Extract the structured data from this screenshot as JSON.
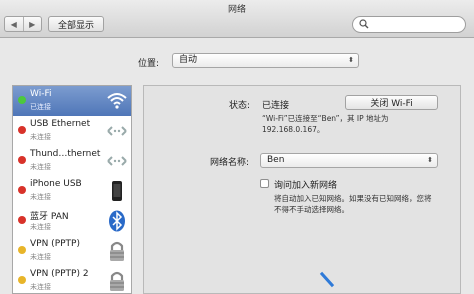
{
  "window": {
    "title": "网络"
  },
  "toolbar": {
    "back_glyph": "◀",
    "forward_glyph": "▶",
    "show_all_label": "全部显示",
    "search_placeholder": ""
  },
  "location": {
    "label": "位置:",
    "value": "自动"
  },
  "services": [
    {
      "name": "Wi-Fi",
      "status": "已连接",
      "dot_color": "#4cc93c",
      "icon": "wifi-icon",
      "selected": true
    },
    {
      "name": "USB Ethernet",
      "status": "未连接",
      "dot_color": "#d8322a",
      "icon": "ethernet-icon",
      "selected": false
    },
    {
      "name": "Thund…thernet",
      "status": "未连接",
      "dot_color": "#d8322a",
      "icon": "ethernet-icon",
      "selected": false
    },
    {
      "name": "iPhone USB",
      "status": "未连接",
      "dot_color": "#d8322a",
      "icon": "iphone-icon",
      "selected": false
    },
    {
      "name": "蓝牙 PAN",
      "status": "未连接",
      "dot_color": "#d8322a",
      "icon": "bluetooth-icon",
      "selected": false
    },
    {
      "name": "VPN (PPTP)",
      "status": "未连接",
      "dot_color": "#e8b52a",
      "icon": "lock-icon",
      "selected": false
    },
    {
      "name": "VPN (PPTP) 2",
      "status": "未连接",
      "dot_color": "#e8b52a",
      "icon": "lock-icon",
      "selected": false
    }
  ],
  "detail": {
    "status_label": "状态:",
    "status_value": "已连接",
    "toggle_button": "关闭 Wi-Fi",
    "status_note_1": "“Wi-Fi”已连接至“Ben”，其 IP 地址为",
    "status_note_2": "192.168.0.167。",
    "network_name_label": "网络名称:",
    "network_name_value": "Ben",
    "ask_join_label": "询问加入新网络",
    "ask_join_checked": false,
    "ask_join_note_1": "将自动加入已知网络。如果没有已知网络，您将",
    "ask_join_note_2": "不得不手动选择网络。"
  },
  "colors": {
    "selection": "#5a7fbe",
    "connected": "#4cc93c",
    "disconnected": "#d8322a",
    "vpn": "#e8b52a"
  }
}
